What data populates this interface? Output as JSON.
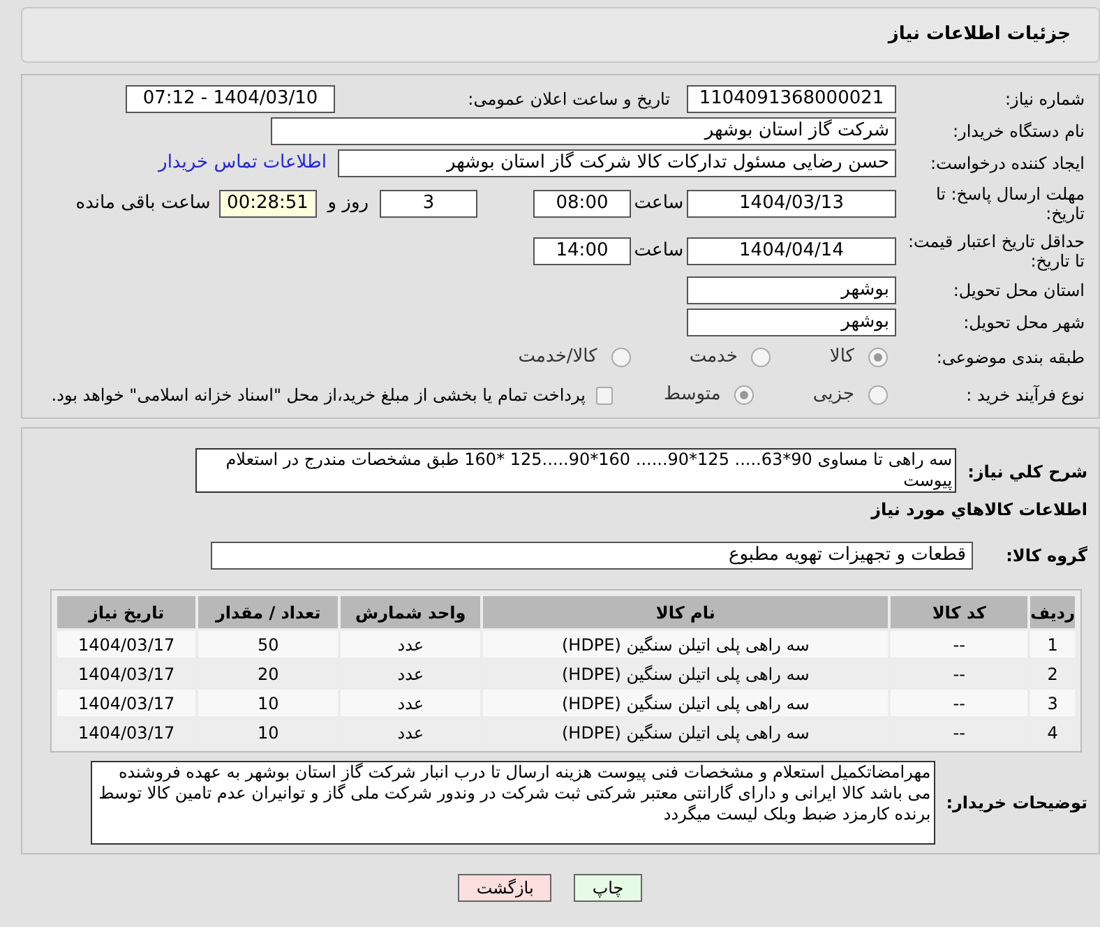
{
  "header": {
    "title": "جزئیات اطلاعات نیاز"
  },
  "need_number": {
    "label": "شماره نیاز:",
    "value": "1104091368000021"
  },
  "announce": {
    "label": "تاریخ و ساعت اعلان عمومی:",
    "value": "1404/03/10 - 07:12"
  },
  "buyer_org": {
    "label": "نام دستگاه خریدار:",
    "value": "شرکت گاز استان بوشهر"
  },
  "creator": {
    "label": "ایجاد کننده درخواست:",
    "value": "حسن رضایی مسئول تدارکات کالا شرکت گاز استان بوشهر",
    "link": "اطلاعات تماس خریدار"
  },
  "deadline": {
    "label": "مهلت ارسال پاسخ: تا تاریخ:",
    "date": "1404/03/13",
    "time_label": "ساعت",
    "time": "08:00",
    "days": "3",
    "days_label": "روز و",
    "remaining": "00:28:51",
    "remaining_label": "ساعت باقی مانده"
  },
  "validity": {
    "label": "حداقل تاریخ اعتبار قیمت: تا تاریخ:",
    "date": "1404/04/14",
    "time_label": "ساعت",
    "time": "14:00"
  },
  "province": {
    "label": "استان محل تحویل:",
    "value": "بوشهر"
  },
  "city": {
    "label": "شهر محل تحویل:",
    "value": "بوشهر"
  },
  "category": {
    "label": "طبقه بندی موضوعی:",
    "options": [
      {
        "label": "کالا",
        "selected": true
      },
      {
        "label": "خدمت",
        "selected": false
      },
      {
        "label": "کالا/خدمت",
        "selected": false
      }
    ]
  },
  "process": {
    "label": "نوع فرآیند خرید :",
    "options": [
      {
        "label": "جزیی",
        "selected": false
      },
      {
        "label": "متوسط",
        "selected": true
      }
    ],
    "treasury": {
      "label": "پرداخت تمام یا بخشی از مبلغ خرید،از محل \"اسناد خزانه اسلامی\" خواهد بود.",
      "checked": false
    }
  },
  "description": {
    "label": "شرح کلي نياز:",
    "value": "سه راهی تا مساوی 90*63..... 125*90......  160*90.....125 *160 طبق مشخصات مندرج در استعلام پیوست"
  },
  "goods_heading": "اطلاعات کالاهاي مورد نياز",
  "goods_group": {
    "label": "گروه کالا:",
    "value": "قطعات و تجهیزات تهویه مطبوع"
  },
  "table": {
    "columns": [
      "ردیف",
      "کد کالا",
      "نام کالا",
      "واحد شمارش",
      "تعداد / مقدار",
      "تاریخ نیاز"
    ],
    "rows": [
      [
        "1",
        "--",
        "سه راهی پلی اتیلن سنگین (HDPE)",
        "عدد",
        "50",
        "1404/03/17"
      ],
      [
        "2",
        "--",
        "سه راهی پلی اتیلن سنگین (HDPE)",
        "عدد",
        "20",
        "1404/03/17"
      ],
      [
        "3",
        "--",
        "سه راهی پلی اتیلن سنگین (HDPE)",
        "عدد",
        "10",
        "1404/03/17"
      ],
      [
        "4",
        "--",
        "سه راهی پلی اتیلن سنگین (HDPE)",
        "عدد",
        "10",
        "1404/03/17"
      ]
    ]
  },
  "buyer_notes": {
    "label": "توضیحات خریدار:",
    "value": "مهرامضاتکمیل استعلام و مشخصات فنی پیوست هزینه ارسال تا درب انبار شرکت گاز استان بوشهر به عهده فروشنده می باشد کالا ایرانی و دارای گارانتی معتبر شرکتی ثبت شرکت در وندور شرکت ملی گاز و توانیران عدم تامین کالا توسط برنده کارمزد ضبط وبلک لیست میگردد"
  },
  "buttons": [
    {
      "kind": "print",
      "label": "چاپ"
    },
    {
      "kind": "back",
      "label": "بازگشت"
    }
  ]
}
